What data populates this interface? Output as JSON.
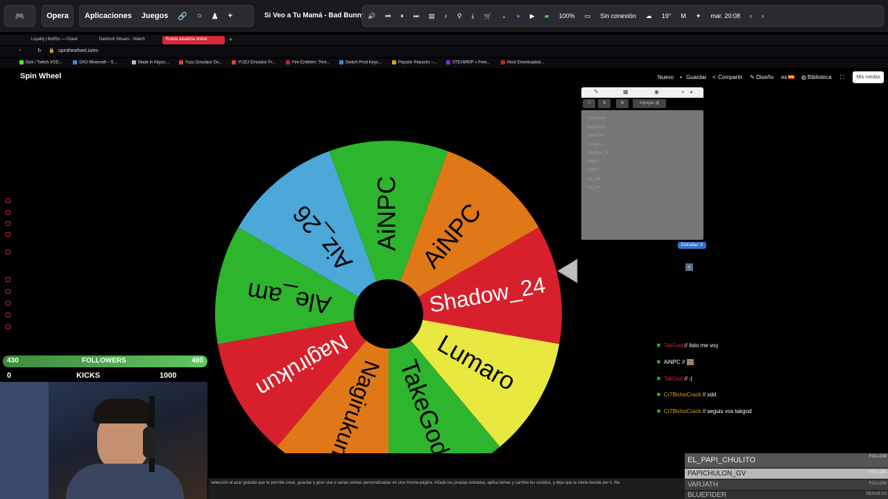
{
  "topbar": {
    "opera_label": "Opera",
    "apps_label": "Aplicaciones",
    "games_label": "Juegos",
    "song_title": "Si Veo a Tu Mamá - Bad Bunny",
    "battery": "100%",
    "network": "Sin conexión",
    "weather": "19°",
    "clock": "mar. 20:08"
  },
  "tabs": [
    {
      "label": "Loyalty | BotRix — Cloud"
    },
    {
      "label": "DaishoX Stream - Watch"
    },
    {
      "label": "Ruleta aleatoria online"
    }
  ],
  "url": "spinthewheel.io/es",
  "bookmarks": [
    {
      "label": "Kick / Twitch VOD...",
      "color": "#53fc18"
    },
    {
      "label": "SAO Minecraft – S...",
      "color": "#3a8ad8"
    },
    {
      "label": "Made in Abyss:...",
      "color": "#b9b9b9"
    },
    {
      "label": "Yuzu Emulator Do...",
      "color": "#e8412c"
    },
    {
      "label": "YUZU Emulator Fr...",
      "color": "#e8412c"
    },
    {
      "label": "Fire Emblem: Thre...",
      "color": "#c02828"
    },
    {
      "label": "Switch Prod Keys...",
      "color": "#3a8ad8"
    },
    {
      "label": "Popular Repacks –...",
      "color": "#d8a028"
    },
    {
      "label": "STEAMRIP » Free...",
      "color": "#8a28d8"
    },
    {
      "label": "Most Downloaded...",
      "color": "#c02828"
    }
  ],
  "site": {
    "logo": "Spin Wheel",
    "nav": {
      "new": "Nuevo",
      "save": "Guardar",
      "share": "Compartir",
      "design": "Diseño",
      "lang": "es",
      "library": "Biblioteca",
      "my_wheels": "Mis ruedas"
    }
  },
  "wheel": {
    "segments": [
      {
        "label": "Shadow_24",
        "color": "#d8202c"
      },
      {
        "label": "Lumaro",
        "color": "#e8e840"
      },
      {
        "label": "TakeGod",
        "color": "#2db52d"
      },
      {
        "label": "Nagirukun",
        "color": "#e07818"
      },
      {
        "label": "Nagirukun",
        "color": "#d8202c"
      },
      {
        "label": "Ale_am",
        "color": "#2db52d"
      },
      {
        "label": "Aiz_26",
        "color": "#4ba8d8"
      },
      {
        "label": "AiNPC",
        "color": "#2db52d"
      },
      {
        "label": "AiNPC",
        "color": "#e07818"
      }
    ]
  },
  "panel": {
    "add_label": "Agregar",
    "entries": [
      "Nagirukun",
      "Nagirukun",
      "TakeGod",
      "Lumaro",
      "Shadow_24",
      "AiNPC",
      "AiNPC",
      "Aiz_26",
      "Ale_am"
    ],
    "count_label": "Entradas: 9"
  },
  "chat": [
    {
      "user": "TakGod",
      "sep": "//",
      "msg": "listo me voy",
      "user_color": "#d8202c"
    },
    {
      "user": "AiNPC",
      "sep": "//",
      "msg": "",
      "user_color": "#ffffff"
    },
    {
      "user": "TakGod",
      "sep": "//",
      "msg": ":(",
      "user_color": "#d8202c"
    },
    {
      "user": "Cr7BichoCrack",
      "sep": "//",
      "msg": "xdd",
      "user_color": "#e8a020"
    },
    {
      "user": "Cr7BichoCrack",
      "sep": "//",
      "msg": "seguis vos takgod",
      "user_color": "#e8a020"
    }
  ],
  "stream_overlay": {
    "followers_left": "430",
    "followers_label": "FOLLOWERS",
    "followers_right": "400",
    "kicks_left": "0",
    "kicks_label": "KICKS",
    "kicks_right": "1000"
  },
  "follow_list": [
    {
      "name": "EL_PAPI_CHULITO",
      "btn": "FOLLOW"
    },
    {
      "name": "PAPICHULON_GV",
      "btn": "FOLLOW"
    },
    {
      "name": "VARJATH",
      "btn": "FOLLOW"
    },
    {
      "name": "BLUEFIDER",
      "btn": "RESUB X3"
    }
  ],
  "footer": {
    "text": "selección al azar gratuita que te permite crear, guardar y girar una o varias ruletas personalizadas en una misma página. Añade tus propias entradas, aplica temas y cambia los sonidos, y deja que la ruleta decida por ti. Na"
  }
}
